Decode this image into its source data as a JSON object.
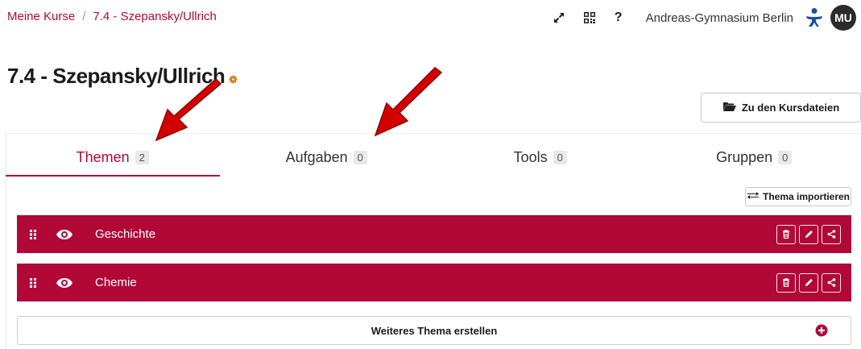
{
  "breadcrumb": {
    "items": [
      "Meine Kurse",
      "7.4 - Szepansky/Ullrich"
    ],
    "separator": "/"
  },
  "header": {
    "school": "Andreas-Gymnasium Berlin",
    "avatar_initials": "MU",
    "help_label": "?"
  },
  "course": {
    "title": "7.4 - Szepansky/Ullrich"
  },
  "files_button": {
    "label": "Zu den Kursdateien"
  },
  "tabs": [
    {
      "label": "Themen",
      "count": "2"
    },
    {
      "label": "Aufgaben",
      "count": "0"
    },
    {
      "label": "Tools",
      "count": "0"
    },
    {
      "label": "Gruppen",
      "count": "0"
    }
  ],
  "import_button": {
    "label": "Thema importieren"
  },
  "topics": [
    {
      "label": "Geschichte"
    },
    {
      "label": "Chemie"
    }
  ],
  "new_topic_button": {
    "label": "Weiteres Thema erstellen"
  },
  "colors": {
    "accent": "#b10838",
    "annotation_arrow": "#d40000"
  },
  "icons": [
    "expand-icon",
    "qr-code-icon",
    "help-icon",
    "school-logo-icon",
    "gear-icon",
    "folder-open-icon",
    "exchange-icon",
    "drag-handle-icon",
    "eye-icon",
    "trash-icon",
    "pencil-icon",
    "share-icon",
    "plus-circle-icon"
  ]
}
